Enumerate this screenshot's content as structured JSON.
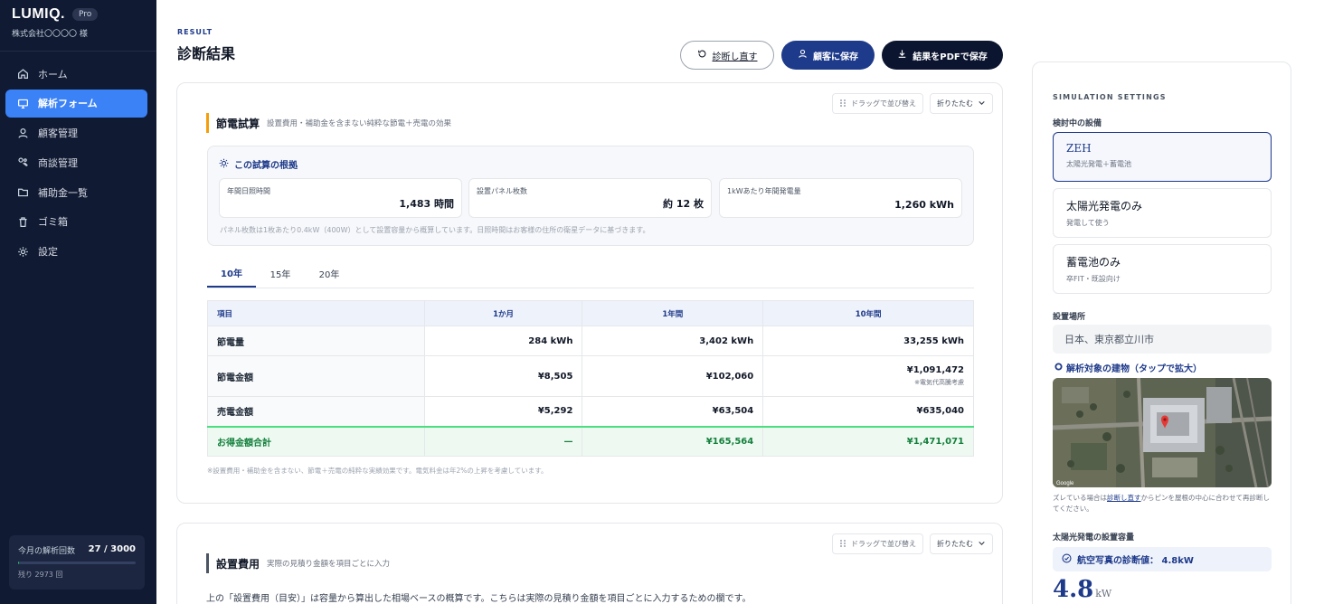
{
  "brand": {
    "name": "LUMIQ.",
    "plan": "Pro",
    "company": "株式会社〇〇〇〇 様"
  },
  "sidebar": {
    "items": [
      {
        "label": "ホーム",
        "icon": "home-icon"
      },
      {
        "label": "解析フォーム",
        "icon": "monitor-icon",
        "active": true
      },
      {
        "label": "顧客管理",
        "icon": "user-icon"
      },
      {
        "label": "商談管理",
        "icon": "handshake-icon"
      },
      {
        "label": "補助金一覧",
        "icon": "folder-icon"
      },
      {
        "label": "ゴミ箱",
        "icon": "trash-icon"
      },
      {
        "label": "設定",
        "icon": "gear-icon"
      }
    ],
    "usage": {
      "label": "今月の解析回数",
      "value": "27 / 3000",
      "fraction": 0.009,
      "remaining": "残り 2973 回"
    }
  },
  "header": {
    "eyebrow": "RESULT",
    "title": "診断結果",
    "buttons": {
      "redo": "診断し直す",
      "save": "顧客に保存",
      "pdf": "結果をPDFで保存"
    }
  },
  "card_actions": {
    "drag": "ドラッグで並び替え",
    "fold": "折りたたむ"
  },
  "savings": {
    "title": "節電試算",
    "subtitle": "設置費用・補助金を含まない純粋な節電＋売電の効果",
    "accent": "#f59e0b",
    "basis": {
      "title": "この試算の根拠",
      "metrics": [
        {
          "label": "年間日照時間",
          "value": "1,483 時間"
        },
        {
          "label": "設置パネル枚数",
          "value": "約 12 枚"
        },
        {
          "label": "1kWあたり年間発電量",
          "value": "1,260 kWh"
        }
      ],
      "note": "パネル枚数は1枚あたり0.4kW（400W）として設置容量から概算しています。日照時間はお客様の住所の衛星データに基づきます。"
    },
    "tabs": [
      "10年",
      "15年",
      "20年"
    ],
    "table": {
      "headers": [
        "項目",
        "1か月",
        "1年間",
        "10年間"
      ],
      "rows": [
        {
          "label": "節電量",
          "m": "284 kWh",
          "y": "3,402 kWh",
          "t": "33,255 kWh"
        },
        {
          "label": "節電金額",
          "m": "¥8,505",
          "y": "¥102,060",
          "t": "¥1,091,472",
          "t_note": "※電気代高騰考慮"
        },
        {
          "label": "売電金額",
          "m": "¥5,292",
          "y": "¥63,504",
          "t": "¥635,040"
        }
      ],
      "total": {
        "label": "お得金額合計",
        "m": "—",
        "y": "¥165,564",
        "t": "¥1,471,071"
      }
    },
    "note": "※設置費用・補助金を含まない、節電＋売電の純粋な実績効果です。電気料金は年2%の上昇を考慮しています。"
  },
  "install": {
    "title": "設置費用",
    "subtitle": "実際の見積り金額を項目ごとに入力",
    "accent": "#4b5563",
    "text": "上の「設置費用（目安）」は容量から算出した相場ベースの概算です。こちらは実際の見積り金額を項目ごとに入力するための欄です。"
  },
  "panel": {
    "title": "SIMULATION SETTINGS",
    "equipment_label": "検討中の設備",
    "equipment": [
      {
        "name": "ZEH",
        "desc": "太陽光発電＋蓄電池",
        "selected": true
      },
      {
        "name": "太陽光発電のみ",
        "desc": "発電して使う"
      },
      {
        "name": "蓄電池のみ",
        "desc": "卒FIT・既設向け"
      }
    ],
    "location_label": "設置場所",
    "location": "日本、東京都立川市",
    "building_link": "解析対象の建物（タップで拡大）",
    "map_note_pre": "ズレている場合は",
    "map_note_link": "診断し直す",
    "map_note_post": "からピンを屋根の中心に合わせて再診断してください。",
    "capacity_title": "太陽光発電の設置容量",
    "diag_text": "航空写真の診断値：  4.8kW",
    "capacity_value": "4.8",
    "capacity_unit": "kW"
  }
}
